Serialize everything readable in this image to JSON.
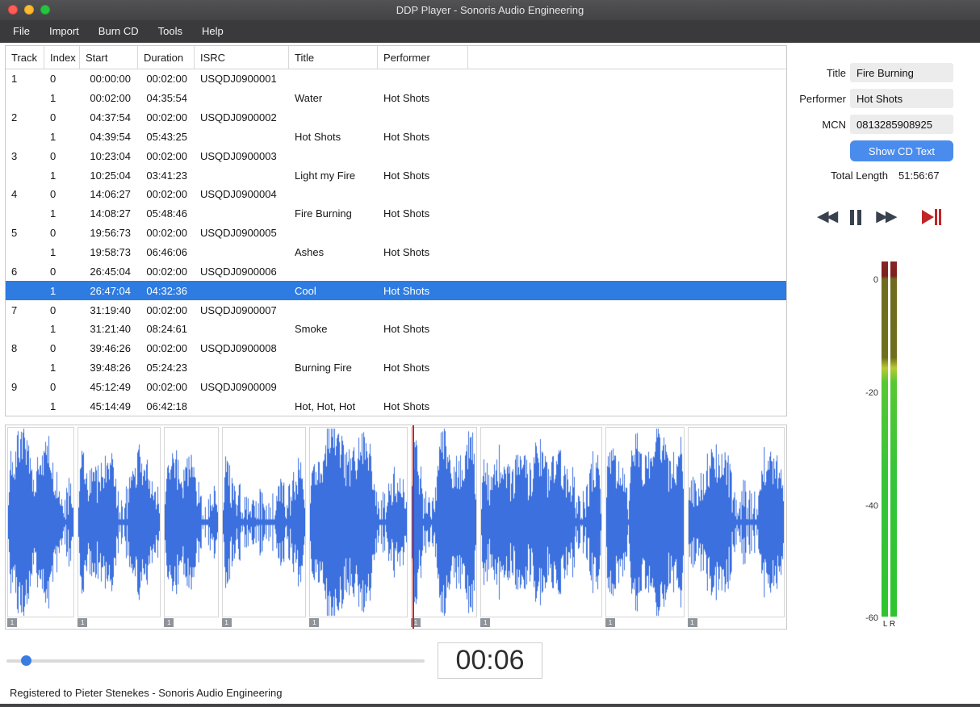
{
  "window": {
    "title": "DDP Player - Sonoris Audio Engineering"
  },
  "menu": {
    "items": [
      "File",
      "Import",
      "Burn CD",
      "Tools",
      "Help"
    ]
  },
  "table": {
    "columns": [
      "Track",
      "Index",
      "Start",
      "Duration",
      "ISRC",
      "Title",
      "Performer"
    ],
    "rows": [
      {
        "track": "1",
        "index": "0",
        "start": "00:00:00",
        "duration": "00:02:00",
        "isrc": "USQDJ0900001",
        "title": "",
        "performer": "",
        "selected": false
      },
      {
        "track": "",
        "index": "1",
        "start": "00:02:00",
        "duration": "04:35:54",
        "isrc": "",
        "title": "Water",
        "performer": "Hot Shots",
        "selected": false
      },
      {
        "track": "2",
        "index": "0",
        "start": "04:37:54",
        "duration": "00:02:00",
        "isrc": "USQDJ0900002",
        "title": "",
        "performer": "",
        "selected": false
      },
      {
        "track": "",
        "index": "1",
        "start": "04:39:54",
        "duration": "05:43:25",
        "isrc": "",
        "title": "Hot Shots",
        "performer": "Hot Shots",
        "selected": false
      },
      {
        "track": "3",
        "index": "0",
        "start": "10:23:04",
        "duration": "00:02:00",
        "isrc": "USQDJ0900003",
        "title": "",
        "performer": "",
        "selected": false
      },
      {
        "track": "",
        "index": "1",
        "start": "10:25:04",
        "duration": "03:41:23",
        "isrc": "",
        "title": "Light my Fire",
        "performer": "Hot Shots",
        "selected": false
      },
      {
        "track": "4",
        "index": "0",
        "start": "14:06:27",
        "duration": "00:02:00",
        "isrc": "USQDJ0900004",
        "title": "",
        "performer": "",
        "selected": false
      },
      {
        "track": "",
        "index": "1",
        "start": "14:08:27",
        "duration": "05:48:46",
        "isrc": "",
        "title": "Fire Burning",
        "performer": "Hot Shots",
        "selected": false
      },
      {
        "track": "5",
        "index": "0",
        "start": "19:56:73",
        "duration": "00:02:00",
        "isrc": "USQDJ0900005",
        "title": "",
        "performer": "",
        "selected": false
      },
      {
        "track": "",
        "index": "1",
        "start": "19:58:73",
        "duration": "06:46:06",
        "isrc": "",
        "title": "Ashes",
        "performer": "Hot Shots",
        "selected": false
      },
      {
        "track": "6",
        "index": "0",
        "start": "26:45:04",
        "duration": "00:02:00",
        "isrc": "USQDJ0900006",
        "title": "",
        "performer": "",
        "selected": false
      },
      {
        "track": "",
        "index": "1",
        "start": "26:47:04",
        "duration": "04:32:36",
        "isrc": "",
        "title": "Cool",
        "performer": "Hot Shots",
        "selected": true
      },
      {
        "track": "7",
        "index": "0",
        "start": "31:19:40",
        "duration": "00:02:00",
        "isrc": "USQDJ0900007",
        "title": "",
        "performer": "",
        "selected": false
      },
      {
        "track": "",
        "index": "1",
        "start": "31:21:40",
        "duration": "08:24:61",
        "isrc": "",
        "title": "Smoke",
        "performer": "Hot Shots",
        "selected": false
      },
      {
        "track": "8",
        "index": "0",
        "start": "39:46:26",
        "duration": "00:02:00",
        "isrc": "USQDJ0900008",
        "title": "",
        "performer": "",
        "selected": false
      },
      {
        "track": "",
        "index": "1",
        "start": "39:48:26",
        "duration": "05:24:23",
        "isrc": "",
        "title": "Burning Fire",
        "performer": "Hot Shots",
        "selected": false
      },
      {
        "track": "9",
        "index": "0",
        "start": "45:12:49",
        "duration": "00:02:00",
        "isrc": "USQDJ0900009",
        "title": "",
        "performer": "",
        "selected": false
      },
      {
        "track": "",
        "index": "1",
        "start": "45:14:49",
        "duration": "06:42:18",
        "isrc": "",
        "title": "Hot, Hot, Hot",
        "performer": "Hot Shots",
        "selected": false
      }
    ]
  },
  "side": {
    "title_label": "Title",
    "title_value": "Fire Burning",
    "performer_label": "Performer",
    "performer_value": "Hot Shots",
    "mcn_label": "MCN",
    "mcn_value": "0813285908925",
    "show_cd_text": "Show CD Text",
    "total_length_label": "Total Length",
    "total_length_value": "51:56:67",
    "meter": {
      "scale": [
        "0",
        "-20",
        "-40",
        "-60"
      ],
      "channels": "L R"
    }
  },
  "transport": {
    "rewind_glyph": "◀◀",
    "fast_forward_glyph": "▶▶"
  },
  "waveform": {
    "marker_label": "1",
    "playhead_segment_index": 5,
    "color": "#3c70df"
  },
  "player": {
    "time": "00:06"
  },
  "status": {
    "text": "Registered to Pieter Stenekes - Sonoris Audio Engineering"
  }
}
